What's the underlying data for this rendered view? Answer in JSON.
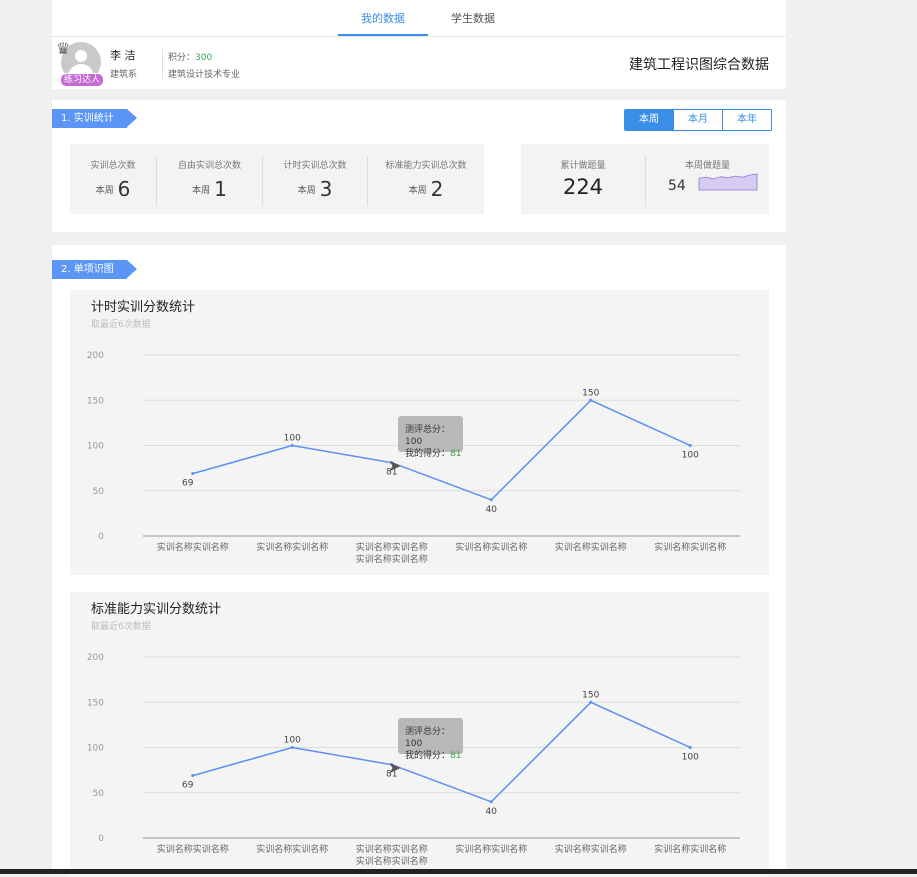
{
  "tabs": [
    "我的数据",
    "学生数据"
  ],
  "profile": {
    "name": "李 洁",
    "dept": "建筑系",
    "points_label": "积分：",
    "points": "300",
    "major": "建筑设计技术专业",
    "badge": "练习达人",
    "page_title": "建筑工程识图综合数据"
  },
  "section1": {
    "label": "1. 实训统计",
    "periods": [
      "本周",
      "本月",
      "本年"
    ],
    "stats": [
      {
        "label": "实训总次数",
        "sub": "本周",
        "value": "6"
      },
      {
        "label": "自由实训总次数",
        "sub": "本周",
        "value": "1"
      },
      {
        "label": "计时实训总次数",
        "sub": "本周",
        "value": "3"
      },
      {
        "label": "标准能力实训总次数",
        "sub": "本周",
        "value": "2"
      }
    ],
    "totals": [
      {
        "label": "累计做题量",
        "value": "224"
      },
      {
        "label": "本周做题量",
        "value": "54"
      }
    ],
    "sparkline": [
      22,
      24,
      21,
      25,
      23,
      26,
      24,
      28,
      30
    ]
  },
  "section2": {
    "label": "2. 单项识图"
  },
  "chart_data": [
    {
      "type": "line",
      "title": "计时实训分数统计",
      "subtitle": "取最近6次数据",
      "categories": [
        "实训名称实训名称",
        "实训名称实训名称",
        "实训名称实训名称\n实训名称实训名称",
        "实训名称实训名称",
        "实训名称实训名称",
        "实训名称实训名称"
      ],
      "values": [
        69,
        100,
        81,
        40,
        150,
        100
      ],
      "yticks": [
        "200",
        "150",
        "100",
        "50",
        "0"
      ],
      "ylim": [
        0,
        200
      ],
      "color": "#5b8ff0",
      "tooltip": {
        "line1_label": "测评总分：",
        "line1_value": "100",
        "line2_label": "我的得分：",
        "line2_value": "81"
      }
    },
    {
      "type": "line",
      "title": "标准能力实训分数统计",
      "subtitle": "取最近6次数据",
      "categories": [
        "实训名称实训名称",
        "实训名称实训名称",
        "实训名称实训名称\n实训名称实训名称",
        "实训名称实训名称",
        "实训名称实训名称",
        "实训名称实训名称"
      ],
      "values": [
        69,
        100,
        81,
        40,
        150,
        100
      ],
      "yticks": [
        "200",
        "150",
        "100",
        "50",
        "0"
      ],
      "ylim": [
        0,
        200
      ],
      "color": "#5b8ff0",
      "tooltip": {
        "line1_label": "测评总分：",
        "line1_value": "100",
        "line2_label": "我的得分：",
        "line2_value": "81"
      }
    }
  ]
}
